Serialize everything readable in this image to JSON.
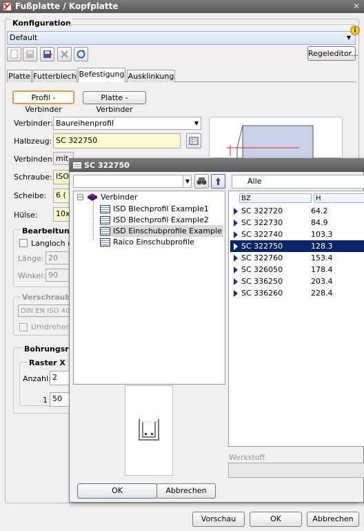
{
  "main": {
    "title": "Fußplatte / Kopfplatte",
    "close": "✕",
    "konfiguration_label": "Konfiguration",
    "konfiguration_value": "Default",
    "regeleditor": "Regeleditor...",
    "tabs": [
      "Platte",
      "Futterblech",
      "Befestigung",
      "Ausklinkung"
    ],
    "profil_verbinder": "Profil - Verbinder",
    "platte_verbinder": "Platte - Verbinder",
    "verbinder_label": "Verbinder:",
    "verbinder_value": "Baureihenprofil",
    "halbzeug_label": "Halbzeug:",
    "halbzeug_value": "SC  322750",
    "verbinden_label": "Verbinden:",
    "verbinden_value": "mit",
    "schraube_label": "Schraube:",
    "schraube_value": "ISO",
    "scheibe_label": "Scheibe:",
    "scheibe_value": "6  (",
    "huelse_label": "Hülse:",
    "huelse_value": "10x",
    "bearbeitung": "Bearbeitung",
    "langloch": "Langloch (F",
    "laenge_label": "Länge:",
    "laenge_value": "20",
    "winkel_label": "Winkel:",
    "winkel_value": "90",
    "verschraube": "Verschraube",
    "din": "DIN EN ISO 40",
    "umdrehen": "Umdrehen",
    "bohrungsra": "Bohrungsra",
    "raster_x": "Raster X",
    "anzahl_label": "Anzahl:",
    "anzahl_value": "2",
    "one": "1",
    "fifty": "50",
    "vorschau": "Vorschau",
    "ok": "OK",
    "abbrechen": "Abbrechen"
  },
  "popup": {
    "title": "SC  322750",
    "filter_value": "Alle",
    "tree_root": "Verbinder",
    "tree_items": [
      "ISD Blechprofil Example1",
      "ISD Blechprofil Example2",
      "ISD Einschubprofile Example",
      "Raico Einschubprofile"
    ],
    "col_bz": "BZ",
    "col_h": "H",
    "rows": [
      {
        "bz": "SC  322720",
        "h": "64.2"
      },
      {
        "bz": "SC  322730",
        "h": "84.9"
      },
      {
        "bz": "SC  322740",
        "h": "103.3"
      },
      {
        "bz": "SC  322750",
        "h": "128.3"
      },
      {
        "bz": "SC  322760",
        "h": "153.4"
      },
      {
        "bz": "SC  326050",
        "h": "178.4"
      },
      {
        "bz": "SC  336250",
        "h": "203.4"
      },
      {
        "bz": "SC  336260",
        "h": "228.4"
      }
    ],
    "selected_index": 3,
    "werkstoff": "Werkstoff",
    "ok": "OK",
    "abbrechen": "Abbrechen"
  }
}
